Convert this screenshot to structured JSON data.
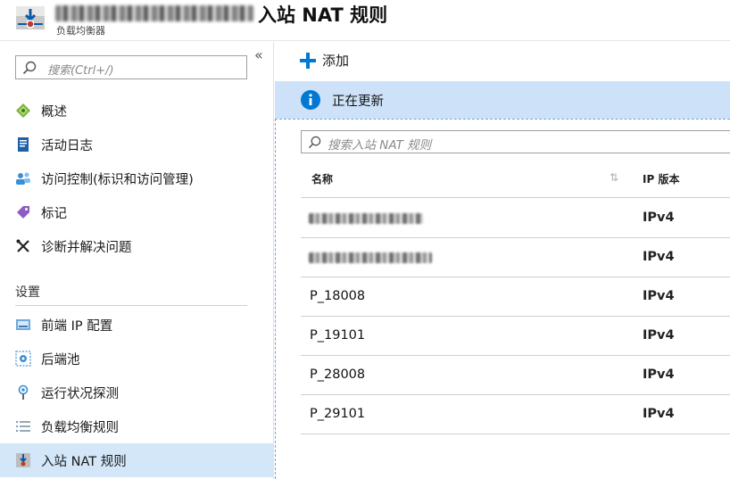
{
  "header": {
    "title": "入站 NAT 规则",
    "resource_type": "负载均衡器"
  },
  "sidebar": {
    "search_placeholder": "搜索(Ctrl+/)",
    "collapse_label": "«",
    "items": [
      {
        "label": "概述",
        "icon": "overview-icon"
      },
      {
        "label": "活动日志",
        "icon": "activity-log-icon"
      },
      {
        "label": "访问控制(标识和访问管理)",
        "icon": "access-control-icon"
      },
      {
        "label": "标记",
        "icon": "tag-icon"
      },
      {
        "label": "诊断并解决问题",
        "icon": "wrench-icon"
      }
    ],
    "section_title": "设置",
    "settings_items": [
      {
        "label": "前端 IP 配置",
        "icon": "frontend-ip-icon"
      },
      {
        "label": "后端池",
        "icon": "backend-pool-icon"
      },
      {
        "label": "运行状况探测",
        "icon": "health-probe-icon"
      },
      {
        "label": "负载均衡规则",
        "icon": "lb-rules-icon"
      },
      {
        "label": "入站 NAT 规则",
        "icon": "inbound-nat-icon",
        "active": true
      }
    ]
  },
  "toolbar": {
    "add_label": "添加"
  },
  "banner": {
    "text": "正在更新"
  },
  "table": {
    "filter_placeholder": "搜索入站 NAT 规则",
    "columns": [
      "名称",
      "IP 版本"
    ],
    "rows": [
      {
        "name": "",
        "ip_version": "IPv4",
        "redacted": true
      },
      {
        "name": "",
        "ip_version": "IPv4",
        "redacted": true
      },
      {
        "name": "P_18008",
        "ip_version": "IPv4"
      },
      {
        "name": "P_19101",
        "ip_version": "IPv4"
      },
      {
        "name": "P_28008",
        "ip_version": "IPv4"
      },
      {
        "name": "P_29101",
        "ip_version": "IPv4"
      }
    ]
  },
  "colors": {
    "accent": "#0078d4",
    "banner_bg": "#cde2f8",
    "active_nav_bg": "#d3e7f9"
  }
}
